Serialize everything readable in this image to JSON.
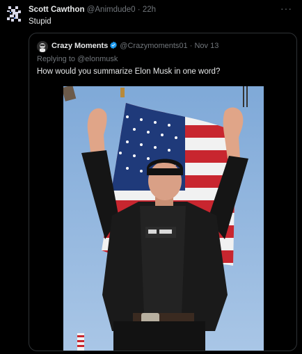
{
  "tweet": {
    "display_name": "Scott Cawthon",
    "handle": "@Animdude0",
    "separator": "·",
    "time": "22h",
    "text": "Stupid",
    "more_icon": "more-horizontal-icon"
  },
  "quote": {
    "display_name": "Crazy Moments",
    "handle": "@Crazymoments01",
    "separator": "·",
    "date": "Nov 13",
    "replying_prefix": "Replying to",
    "replying_handle": "@elonmusk",
    "text": "How would you summarize Elon Musk in one word?",
    "verified_color": "#1d9bf0",
    "image_description_icon": "photo-man-arms-raised-flag"
  },
  "colors": {
    "background": "#000000",
    "text": "#e7e9ea",
    "muted": "#71767b",
    "border": "#2f3336"
  }
}
